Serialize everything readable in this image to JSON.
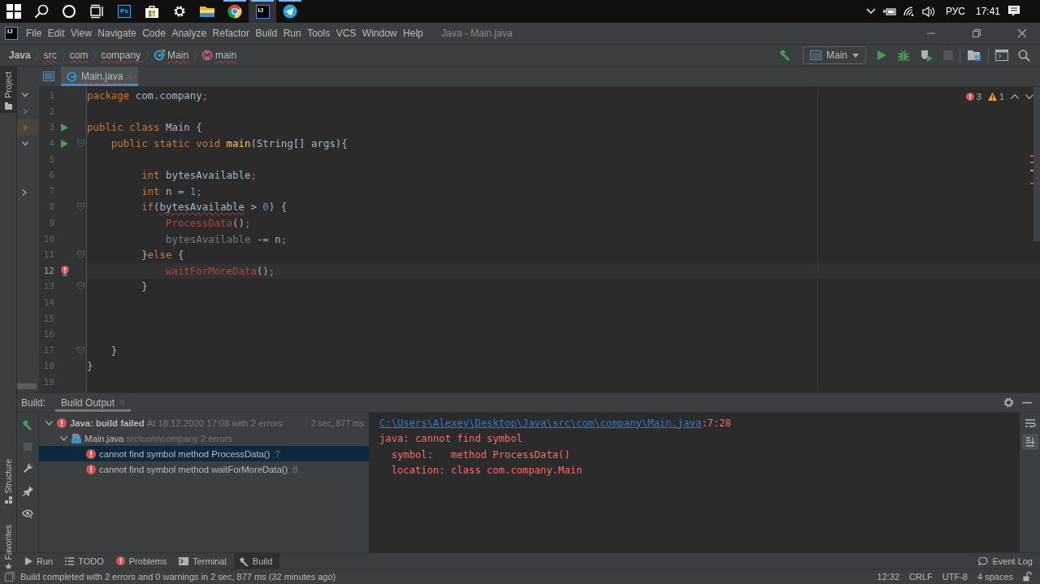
{
  "taskbar": {
    "apps": [
      {
        "kind": "windows",
        "running": false,
        "active": false
      },
      {
        "kind": "search",
        "running": false,
        "active": false
      },
      {
        "kind": "cortana",
        "running": false,
        "active": false
      },
      {
        "kind": "taskview",
        "running": false,
        "active": false
      },
      {
        "kind": "photoshop",
        "label": "Ps",
        "running": false,
        "active": false
      },
      {
        "kind": "store",
        "running": false,
        "active": false
      },
      {
        "kind": "settings",
        "running": false,
        "active": false
      },
      {
        "kind": "folder",
        "running": false,
        "active": false
      },
      {
        "kind": "chrome",
        "running": true,
        "active": false
      },
      {
        "kind": "intellij",
        "label": "IJ",
        "running": true,
        "active": true
      },
      {
        "kind": "telegram",
        "running": true,
        "active": false
      }
    ],
    "tray": {
      "language": "РУС",
      "time": "17:41"
    }
  },
  "window": {
    "logo": "IJ",
    "title": "Java - Main.java",
    "menu": [
      "File",
      "Edit",
      "View",
      "Navigate",
      "Code",
      "Analyze",
      "Refactor",
      "Build",
      "Run",
      "Tools",
      "VCS",
      "Window",
      "Help"
    ]
  },
  "breadcrumbs": [
    {
      "text": "Java",
      "kind": "module",
      "error": false
    },
    {
      "text": "src",
      "kind": "folder",
      "error": true
    },
    {
      "text": "com",
      "kind": "folder",
      "error": true
    },
    {
      "text": "company",
      "kind": "folder",
      "error": true
    },
    {
      "text": "Main",
      "kind": "class",
      "error": true
    },
    {
      "text": "main",
      "kind": "method",
      "error": true
    }
  ],
  "toolbar": {
    "run_config": "Main"
  },
  "side_tabs": [
    {
      "label": "Project",
      "selected": true
    },
    {
      "label": "Structure",
      "selected": false
    },
    {
      "label": "Favorites",
      "selected": false
    }
  ],
  "editor": {
    "tabs": [
      {
        "label": "Main.java",
        "selected": true
      }
    ],
    "error_count": "3",
    "warning_count": "1",
    "lines": [
      {
        "number": "1",
        "current": false,
        "run_marker": false,
        "error_marker": false,
        "fold": false,
        "tokens": [
          {
            "text": "package",
            "kind": "keyword"
          },
          {
            "text": " com.company",
            "kind": "plain"
          },
          {
            "text": ";",
            "kind": "keyword"
          }
        ]
      },
      {
        "number": "2",
        "current": false,
        "run_marker": false,
        "error_marker": false,
        "fold": false
      },
      {
        "number": "3",
        "current": false,
        "run_marker": true,
        "error_marker": false,
        "fold": false,
        "tokens": [
          {
            "text": "public class",
            "kind": "keyword"
          },
          {
            "text": " Main {",
            "kind": "plain"
          }
        ]
      },
      {
        "number": "4",
        "current": false,
        "run_marker": true,
        "error_marker": false,
        "fold": true,
        "tokens": [
          {
            "text": "    public static void ",
            "kind": "keyword"
          },
          {
            "text": "main",
            "kind": "declaration"
          },
          {
            "text": "(String[] args){",
            "kind": "plain"
          }
        ]
      },
      {
        "number": "5",
        "current": false,
        "run_marker": false,
        "error_marker": false,
        "fold": false
      },
      {
        "number": "6",
        "current": false,
        "run_marker": false,
        "error_marker": false,
        "fold": false,
        "tokens": [
          {
            "text": "         int",
            "kind": "keyword"
          },
          {
            "text": " bytesAvailable",
            "kind": "plain"
          },
          {
            "text": ";",
            "kind": "keyword"
          }
        ]
      },
      {
        "number": "7",
        "current": false,
        "run_marker": false,
        "error_marker": false,
        "fold": false,
        "tokens": [
          {
            "text": "         int",
            "kind": "keyword"
          },
          {
            "text": " n = ",
            "kind": "plain"
          },
          {
            "text": "1",
            "kind": "number"
          },
          {
            "text": ";",
            "kind": "keyword"
          }
        ]
      },
      {
        "number": "8",
        "current": false,
        "run_marker": false,
        "error_marker": false,
        "fold": true,
        "tokens": [
          {
            "text": "         if",
            "kind": "keyword"
          },
          {
            "text": "(",
            "kind": "plain"
          },
          {
            "text": "bytesAvailable",
            "kind": "flagged"
          },
          {
            "text": " > ",
            "kind": "plain"
          },
          {
            "text": "0",
            "kind": "number"
          },
          {
            "text": ") {",
            "kind": "plain"
          }
        ]
      },
      {
        "number": "9",
        "current": false,
        "run_marker": false,
        "error_marker": false,
        "fold": false,
        "tokens": [
          {
            "text": "             ProcessData",
            "kind": "error"
          },
          {
            "text": "()",
            "kind": "plain"
          },
          {
            "text": ";",
            "kind": "keyword"
          }
        ]
      },
      {
        "number": "10",
        "current": false,
        "run_marker": false,
        "error_marker": false,
        "fold": false,
        "tokens": [
          {
            "text": "             bytesAvailable",
            "kind": "unused"
          },
          {
            "text": " -= n",
            "kind": "plain"
          },
          {
            "text": ";",
            "kind": "keyword"
          }
        ]
      },
      {
        "number": "11",
        "current": false,
        "run_marker": false,
        "error_marker": false,
        "fold": true,
        "tokens": [
          {
            "text": "         }",
            "kind": "plain"
          },
          {
            "text": "else",
            "kind": "keyword"
          },
          {
            "text": " {",
            "kind": "plain"
          }
        ]
      },
      {
        "number": "12",
        "current": true,
        "run_marker": false,
        "error_marker": true,
        "fold": false,
        "tokens": [
          {
            "text": "             waitForMoreData",
            "kind": "error"
          },
          {
            "text": "()",
            "kind": "plain"
          },
          {
            "text": ";",
            "kind": "keyword"
          }
        ]
      },
      {
        "number": "13",
        "current": false,
        "run_marker": false,
        "error_marker": false,
        "fold": true,
        "tokens": [
          {
            "text": "         }",
            "kind": "plain"
          }
        ]
      },
      {
        "number": "14",
        "current": false,
        "run_marker": false,
        "error_marker": false,
        "fold": false
      },
      {
        "number": "15",
        "current": false,
        "run_marker": false,
        "error_marker": false,
        "fold": false
      },
      {
        "number": "16",
        "current": false,
        "run_marker": false,
        "error_marker": false,
        "fold": false
      },
      {
        "number": "17",
        "current": false,
        "run_marker": false,
        "error_marker": false,
        "fold": true,
        "tokens": [
          {
            "text": "    }",
            "kind": "plain"
          }
        ]
      },
      {
        "number": "18",
        "current": false,
        "run_marker": false,
        "error_marker": false,
        "fold": false,
        "tokens": [
          {
            "text": "}",
            "kind": "plain"
          }
        ]
      },
      {
        "number": "19",
        "current": false,
        "run_marker": false,
        "error_marker": false,
        "fold": false
      }
    ]
  },
  "build": {
    "label": "Build:",
    "tabs": [
      {
        "label": "Build Output",
        "selected": true
      }
    ],
    "tree": [
      {
        "kind": "failed",
        "title": "Java: build failed",
        "detail": "At 18.12.2020 17:08 with 2 errors",
        "time": "2 sec, 877 ms",
        "expanded": true,
        "selected": false,
        "children": [
          {
            "kind": "file",
            "title": "Main.java",
            "detail": "src\\com\\company 2 errors",
            "expanded": true,
            "selected": false,
            "children": [
              {
                "kind": "error",
                "title": "cannot find symbol method ProcessData()",
                "detail": ":7",
                "selected": true
              },
              {
                "kind": "error",
                "title": "cannot find symbol method waitForMoreData()",
                "detail": ":8",
                "selected": false
              }
            ]
          }
        ]
      }
    ],
    "console": [
      {
        "kind": "link",
        "text": "C:\\Users\\Alexey\\Desktop\\Java\\src\\com\\company\\Main.java",
        "suffix": ":7:28"
      },
      {
        "kind": "error",
        "text": "java: cannot find symbol"
      },
      {
        "kind": "error",
        "text": "  symbol:   method ProcessData()"
      },
      {
        "kind": "error",
        "text": "  location: class com.company.Main"
      }
    ]
  },
  "bottom_tabs": [
    {
      "label": "Run",
      "kind": "run",
      "selected": false
    },
    {
      "label": "TODO",
      "kind": "todo",
      "selected": false
    },
    {
      "label": "Problems",
      "kind": "problems",
      "selected": false
    },
    {
      "label": "Terminal",
      "kind": "terminal",
      "selected": false
    },
    {
      "label": "Build",
      "kind": "build",
      "selected": true
    }
  ],
  "event_log": "Event Log",
  "status_bar": {
    "message": "Build completed with 2 errors and 0 warnings in 2 sec, 877 ms (32 minutes ago)",
    "position": "12:32",
    "line_separator": "CRLF",
    "encoding": "UTF-8",
    "indent": "4 spaces"
  }
}
